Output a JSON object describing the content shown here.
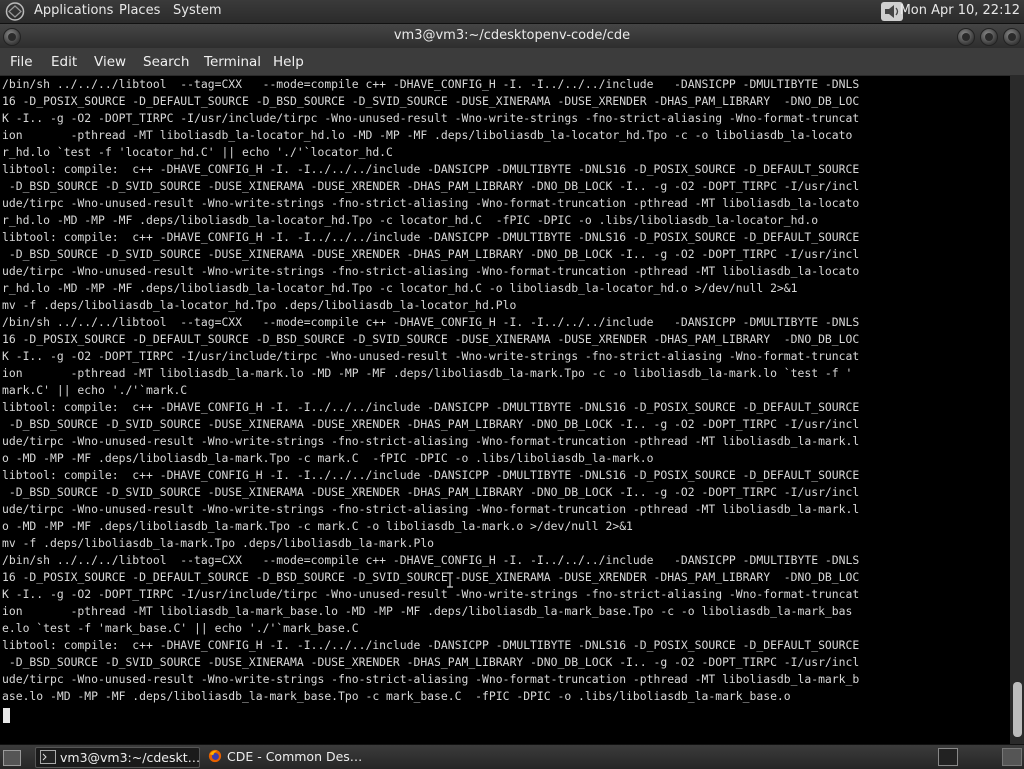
{
  "top_panel": {
    "menus": [
      "Applications",
      "Places",
      "System"
    ],
    "clock": "Mon Apr 10, 22:12",
    "icons": {
      "logo": "distro-logo-icon",
      "sound": "speaker-icon"
    }
  },
  "window": {
    "title": "vm3@vm3:~/cdesktopenv-code/cde"
  },
  "menubar": [
    "File",
    "Edit",
    "View",
    "Search",
    "Terminal",
    "Help"
  ],
  "terminal": {
    "lines": [
      "/bin/sh ../../../libtool  --tag=CXX   --mode=compile c++ -DHAVE_CONFIG_H -I. -I../../../include   -DANSICPP -DMULTIBYTE -DNLS",
      "16 -D_POSIX_SOURCE -D_DEFAULT_SOURCE -D_BSD_SOURCE -D_SVID_SOURCE -DUSE_XINERAMA -DUSE_XRENDER -DHAS_PAM_LIBRARY  -DNO_DB_LOC",
      "K -I.. -g -O2 -DOPT_TIRPC -I/usr/include/tirpc -Wno-unused-result -Wno-write-strings -fno-strict-aliasing -Wno-format-truncat",
      "ion       -pthread -MT liboliasdb_la-locator_hd.lo -MD -MP -MF .deps/liboliasdb_la-locator_hd.Tpo -c -o liboliasdb_la-locato",
      "r_hd.lo `test -f 'locator_hd.C' || echo './'`locator_hd.C",
      "libtool: compile:  c++ -DHAVE_CONFIG_H -I. -I../../../include -DANSICPP -DMULTIBYTE -DNLS16 -D_POSIX_SOURCE -D_DEFAULT_SOURCE",
      " -D_BSD_SOURCE -D_SVID_SOURCE -DUSE_XINERAMA -DUSE_XRENDER -DHAS_PAM_LIBRARY -DNO_DB_LOCK -I.. -g -O2 -DOPT_TIRPC -I/usr/incl",
      "ude/tirpc -Wno-unused-result -Wno-write-strings -fno-strict-aliasing -Wno-format-truncation -pthread -MT liboliasdb_la-locato",
      "r_hd.lo -MD -MP -MF .deps/liboliasdb_la-locator_hd.Tpo -c locator_hd.C  -fPIC -DPIC -o .libs/liboliasdb_la-locator_hd.o",
      "libtool: compile:  c++ -DHAVE_CONFIG_H -I. -I../../../include -DANSICPP -DMULTIBYTE -DNLS16 -D_POSIX_SOURCE -D_DEFAULT_SOURCE",
      " -D_BSD_SOURCE -D_SVID_SOURCE -DUSE_XINERAMA -DUSE_XRENDER -DHAS_PAM_LIBRARY -DNO_DB_LOCK -I.. -g -O2 -DOPT_TIRPC -I/usr/incl",
      "ude/tirpc -Wno-unused-result -Wno-write-strings -fno-strict-aliasing -Wno-format-truncation -pthread -MT liboliasdb_la-locato",
      "r_hd.lo -MD -MP -MF .deps/liboliasdb_la-locator_hd.Tpo -c locator_hd.C -o liboliasdb_la-locator_hd.o >/dev/null 2>&1",
      "mv -f .deps/liboliasdb_la-locator_hd.Tpo .deps/liboliasdb_la-locator_hd.Plo",
      "/bin/sh ../../../libtool  --tag=CXX   --mode=compile c++ -DHAVE_CONFIG_H -I. -I../../../include   -DANSICPP -DMULTIBYTE -DNLS",
      "16 -D_POSIX_SOURCE -D_DEFAULT_SOURCE -D_BSD_SOURCE -D_SVID_SOURCE -DUSE_XINERAMA -DUSE_XRENDER -DHAS_PAM_LIBRARY  -DNO_DB_LOC",
      "K -I.. -g -O2 -DOPT_TIRPC -I/usr/include/tirpc -Wno-unused-result -Wno-write-strings -fno-strict-aliasing -Wno-format-truncat",
      "ion       -pthread -MT liboliasdb_la-mark.lo -MD -MP -MF .deps/liboliasdb_la-mark.Tpo -c -o liboliasdb_la-mark.lo `test -f '",
      "mark.C' || echo './'`mark.C",
      "libtool: compile:  c++ -DHAVE_CONFIG_H -I. -I../../../include -DANSICPP -DMULTIBYTE -DNLS16 -D_POSIX_SOURCE -D_DEFAULT_SOURCE",
      " -D_BSD_SOURCE -D_SVID_SOURCE -DUSE_XINERAMA -DUSE_XRENDER -DHAS_PAM_LIBRARY -DNO_DB_LOCK -I.. -g -O2 -DOPT_TIRPC -I/usr/incl",
      "ude/tirpc -Wno-unused-result -Wno-write-strings -fno-strict-aliasing -Wno-format-truncation -pthread -MT liboliasdb_la-mark.l",
      "o -MD -MP -MF .deps/liboliasdb_la-mark.Tpo -c mark.C  -fPIC -DPIC -o .libs/liboliasdb_la-mark.o",
      "libtool: compile:  c++ -DHAVE_CONFIG_H -I. -I../../../include -DANSICPP -DMULTIBYTE -DNLS16 -D_POSIX_SOURCE -D_DEFAULT_SOURCE",
      " -D_BSD_SOURCE -D_SVID_SOURCE -DUSE_XINERAMA -DUSE_XRENDER -DHAS_PAM_LIBRARY -DNO_DB_LOCK -I.. -g -O2 -DOPT_TIRPC -I/usr/incl",
      "ude/tirpc -Wno-unused-result -Wno-write-strings -fno-strict-aliasing -Wno-format-truncation -pthread -MT liboliasdb_la-mark.l",
      "o -MD -MP -MF .deps/liboliasdb_la-mark.Tpo -c mark.C -o liboliasdb_la-mark.o >/dev/null 2>&1",
      "mv -f .deps/liboliasdb_la-mark.Tpo .deps/liboliasdb_la-mark.Plo",
      "/bin/sh ../../../libtool  --tag=CXX   --mode=compile c++ -DHAVE_CONFIG_H -I. -I../../../include   -DANSICPP -DMULTIBYTE -DNLS",
      "16 -D_POSIX_SOURCE -D_DEFAULT_SOURCE -D_BSD_SOURCE -D_SVID_SOURCE -DUSE_XINERAMA -DUSE_XRENDER -DHAS_PAM_LIBRARY  -DNO_DB_LOC",
      "K -I.. -g -O2 -DOPT_TIRPC -I/usr/include/tirpc -Wno-unused-result -Wno-write-strings -fno-strict-aliasing -Wno-format-truncat",
      "ion       -pthread -MT liboliasdb_la-mark_base.lo -MD -MP -MF .deps/liboliasdb_la-mark_base.Tpo -c -o liboliasdb_la-mark_bas",
      "e.lo `test -f 'mark_base.C' || echo './'`mark_base.C",
      "libtool: compile:  c++ -DHAVE_CONFIG_H -I. -I../../../include -DANSICPP -DMULTIBYTE -DNLS16 -D_POSIX_SOURCE -D_DEFAULT_SOURCE",
      " -D_BSD_SOURCE -D_SVID_SOURCE -DUSE_XINERAMA -DUSE_XRENDER -DHAS_PAM_LIBRARY -DNO_DB_LOCK -I.. -g -O2 -DOPT_TIRPC -I/usr/incl",
      "ude/tirpc -Wno-unused-result -Wno-write-strings -fno-strict-aliasing -Wno-format-truncation -pthread -MT liboliasdb_la-mark_b",
      "ase.lo -MD -MP -MF .deps/liboliasdb_la-mark_base.Tpo -c mark_base.C  -fPIC -DPIC -o .libs/liboliasdb_la-mark_base.o"
    ]
  },
  "taskbar": {
    "tasks": [
      {
        "label": "vm3@vm3:~/cdeskt…",
        "icon": "terminal-icon"
      },
      {
        "label": "CDE - Common Des…",
        "icon": "firefox-icon"
      }
    ],
    "tray_icons": [
      "terminal-icon",
      "workspace-switcher-icon"
    ]
  },
  "colors": {
    "terminal_bg": "#000000",
    "terminal_fg": "#d8d8d8",
    "panel_bg": "#2e2e2e"
  }
}
